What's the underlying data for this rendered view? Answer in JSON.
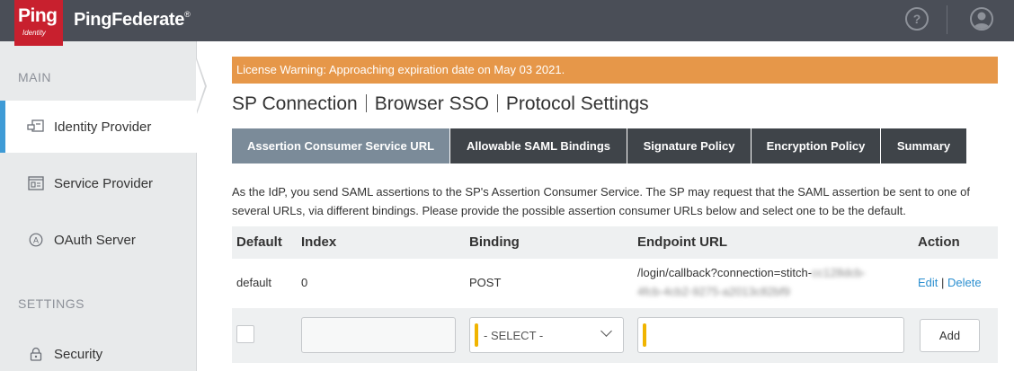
{
  "header": {
    "logo_text": "Ping",
    "logo_sub": "Identity",
    "brand": "PingFederate",
    "brand_mark": "®",
    "help_icon": "question-circle-icon",
    "user_icon": "user-circle-icon"
  },
  "sidebar": {
    "sections": [
      {
        "title": "MAIN"
      },
      {
        "title": "SETTINGS"
      }
    ],
    "items": [
      {
        "label": "Identity Provider",
        "icon": "identity-provider-icon",
        "active": true
      },
      {
        "label": "Service Provider",
        "icon": "service-provider-icon",
        "active": false
      },
      {
        "label": "OAuth Server",
        "icon": "oauth-server-icon",
        "active": false
      },
      {
        "label": "Security",
        "icon": "lock-icon",
        "active": false
      }
    ]
  },
  "main": {
    "warning": "License Warning: Approaching expiration date on May 03 2021.",
    "breadcrumb": [
      "SP Connection",
      "Browser SSO",
      "Protocol Settings"
    ],
    "tabs": [
      {
        "label": "Assertion Consumer Service URL",
        "active": true
      },
      {
        "label": "Allowable SAML Bindings",
        "active": false
      },
      {
        "label": "Signature Policy",
        "active": false
      },
      {
        "label": "Encryption Policy",
        "active": false
      },
      {
        "label": "Summary",
        "active": false
      }
    ],
    "description": "As the IdP, you send SAML assertions to the SP's Assertion Consumer Service. The SP may request that the SAML assertion be sent to one of several URLs, via different bindings. Please provide the possible assertion consumer URLs below and select one to be the default.",
    "table": {
      "columns": [
        "Default",
        "Index",
        "Binding",
        "Endpoint URL",
        "Action"
      ],
      "rows": [
        {
          "default": "default",
          "index": "0",
          "binding": "POST",
          "endpoint_line1": "/login/callback?connection=stitch-",
          "endpoint_blur1": "cc128dcb-",
          "endpoint_blur2": "4fcb-4cb2-9275-a2013c82bf9",
          "edit": "Edit",
          "action_sep": "|",
          "delete": "Delete"
        }
      ],
      "new_row": {
        "binding_select": "- SELECT -",
        "add_label": "Add"
      }
    }
  }
}
